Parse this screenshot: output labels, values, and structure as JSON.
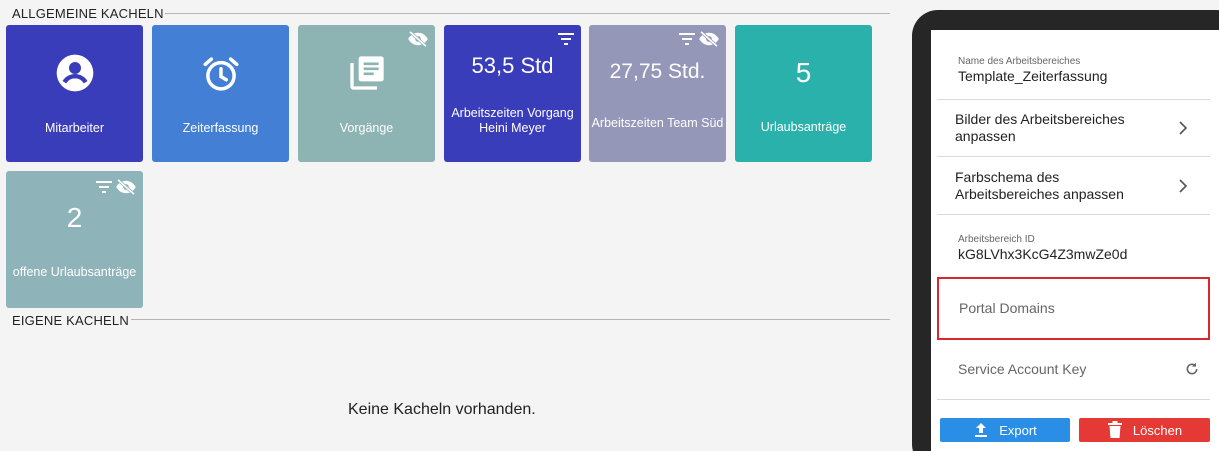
{
  "sections": {
    "general": "ALLGEMEINE KACHELN",
    "own": "EIGENE KACHELN"
  },
  "tiles": [
    {
      "label": "Mitarbeiter",
      "color": "#3a3dba",
      "icon": "person-icon"
    },
    {
      "label": "Zeiterfassung",
      "color": "#437fd4",
      "icon": "alarm-clock-icon"
    },
    {
      "label": "Vorgänge",
      "color": "#8eb3b3",
      "icon": "documents-icon",
      "top_icons": [
        "visibility-off-icon"
      ]
    },
    {
      "label": "Arbeitszeiten Vorgang Heini Meyer",
      "value": "53,5 Std",
      "color": "#3a3dba",
      "top_icons": [
        "filter-icon"
      ]
    },
    {
      "label": "Arbeitszeiten Team Süd",
      "value": "27,75 Std.",
      "color": "#9597b8",
      "top_icons": [
        "filter-icon",
        "visibility-off-icon"
      ]
    },
    {
      "label": "Urlaubsanträge",
      "value": "5",
      "color": "#2bb1ab"
    },
    {
      "label": "offene Urlaubsanträge",
      "value": "2",
      "color": "#8eb3b8",
      "top_icons": [
        "filter-icon",
        "visibility-off-icon"
      ]
    }
  ],
  "empty_message": "Keine Kacheln vorhanden.",
  "panel": {
    "workspace_name_label": "Name des Arbeitsbereiches",
    "workspace_name": "Template_Zeiterfassung",
    "images_link": "Bilder des Arbeitsbereiches anpassen",
    "colors_link": "Farbschema des Arbeitsbereiches anpassen",
    "workspace_id_label": "Arbeitsbereich ID",
    "workspace_id": "kG8LVhx3KcG4Z3mwZe0d",
    "portal_domains": "Portal Domains",
    "service_account_key": "Service Account Key",
    "export_label": "Export",
    "delete_label": "Löschen"
  },
  "colors": {
    "highlight_border": "#d9272e",
    "export": "#2a8ee6",
    "delete": "#e53935"
  }
}
